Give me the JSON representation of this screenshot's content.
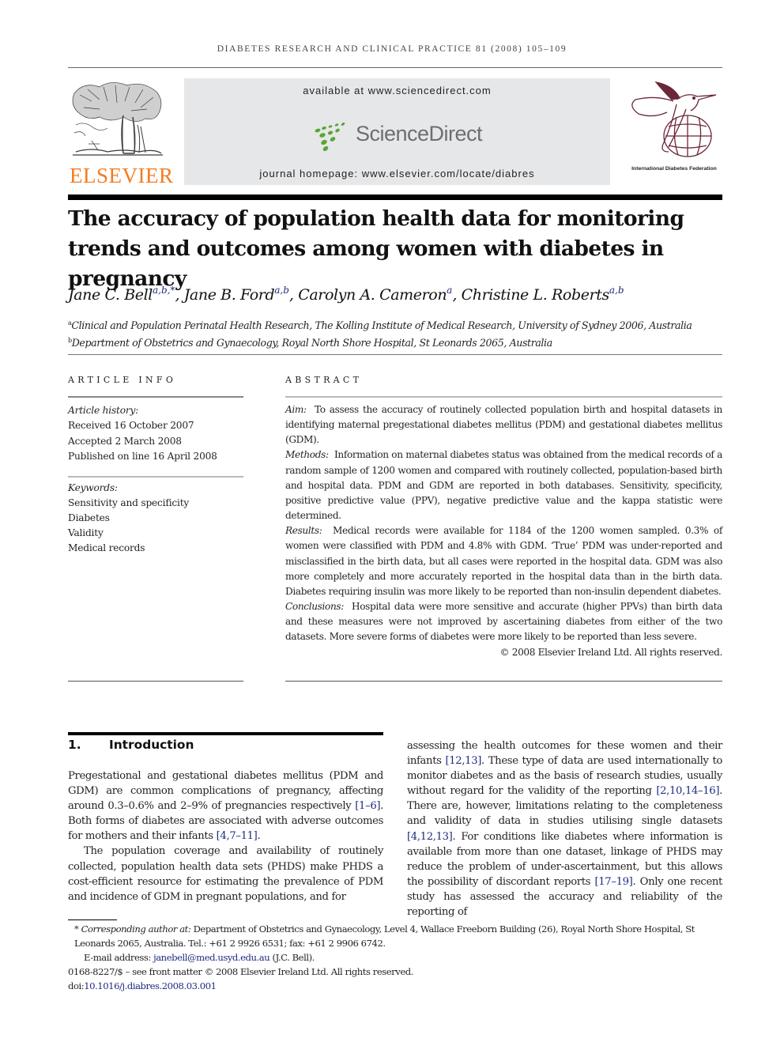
{
  "running_head": "Diabetes Research and Clinical Practice 81 (2008) 105–109",
  "banner": {
    "publisher_logo_text": "ELSEVIER",
    "available_at": "available at www.sciencedirect.com",
    "platform_name": "ScienceDirect",
    "journal_homepage": "journal homepage: www.elsevier.com/locate/diabres",
    "society_name": "International Diabetes Federation",
    "colors": {
      "elsevier_orange": "#f47c20",
      "sciencedirect_green": "#5aa532",
      "idf_maroon": "#6b2737",
      "banner_grey": "#e6e7e8",
      "link_blue": "#1f2a80"
    }
  },
  "article": {
    "title": "The accuracy of population health data for monitoring trends and outcomes among women with diabetes in pregnancy",
    "authors": [
      {
        "name": "Jane C. Bell",
        "affil": "a,b,*"
      },
      {
        "name": "Jane B. Ford",
        "affil": "a,b"
      },
      {
        "name": "Carolyn A. Cameron",
        "affil": "a"
      },
      {
        "name": "Christine L. Roberts",
        "affil": "a,b"
      }
    ],
    "affiliations": [
      {
        "mark": "a",
        "text": "Clinical and Population Perinatal Health Research, The Kolling Institute of Medical Research, University of Sydney 2006, Australia"
      },
      {
        "mark": "b",
        "text": "Department of Obstetrics and Gynaecology, Royal North Shore Hospital, St Leonards 2065, Australia"
      }
    ]
  },
  "article_info": {
    "label": "Article Info",
    "history_label": "Article history:",
    "history": [
      "Received 16 October 2007",
      "Accepted 2 March 2008",
      "Published on line 16 April 2008"
    ],
    "keywords_label": "Keywords:",
    "keywords": [
      "Sensitivity and specificity",
      "Diabetes",
      "Validity",
      "Medical records"
    ]
  },
  "abstract": {
    "label": "Abstract",
    "sections": [
      {
        "label": "Aim:",
        "text": "To assess the accuracy of routinely collected population birth and hospital datasets in identifying maternal pregestational diabetes mellitus (PDM) and gestational diabetes mellitus (GDM)."
      },
      {
        "label": "Methods:",
        "text": "Information on maternal diabetes status was obtained from the medical records of a random sample of 1200 women and compared with routinely collected, population-based birth and hospital data. PDM and GDM are reported in both databases. Sensitivity, specificity, positive predictive value (PPV), negative predictive value and the kappa statistic were determined."
      },
      {
        "label": "Results:",
        "text": "Medical records were available for 1184 of the 1200 women sampled. 0.3% of women were classified with PDM and 4.8% with GDM. ‘True’ PDM was under-reported and misclassified in the birth data, but all cases were reported in the hospital data. GDM was also more completely and more accurately reported in the hospital data than in the birth data. Diabetes requiring insulin was more likely to be reported than non-insulin dependent diabetes."
      },
      {
        "label": "Conclusions:",
        "text": "Hospital data were more sensitive and accurate (higher PPVs) than birth data and these measures were not improved by ascertaining diabetes from either of the two datasets. More severe forms of diabetes were more likely to be reported than less severe."
      }
    ],
    "copyright": "© 2008 Elsevier Ireland Ltd. All rights reserved."
  },
  "introduction": {
    "number": "1.",
    "heading": "Introduction",
    "left_column": [
      {
        "indent": false,
        "parts": [
          {
            "t": "Pregestational and gestational diabetes mellitus (PDM and GDM) are common complications of pregnancy, affecting around 0.3–0.6% and 2–9% of pregnancies respectively "
          },
          {
            "ref": "[1–6]"
          },
          {
            "t": ". Both forms of diabetes are associated with adverse outcomes for mothers and their infants "
          },
          {
            "ref": "[4,7–11]"
          },
          {
            "t": "."
          }
        ]
      },
      {
        "indent": true,
        "parts": [
          {
            "t": "The population coverage and availability of routinely collected, population health data sets (PHDS) make PHDS a cost-efficient resource for estimating the prevalence of PDM and incidence of GDM in pregnant populations, and for"
          }
        ]
      }
    ],
    "right_column": [
      {
        "indent": false,
        "parts": [
          {
            "t": "assessing the health outcomes for these women and their infants "
          },
          {
            "ref": "[12,13]"
          },
          {
            "t": ". These type of data are used internationally to monitor diabetes and as the basis of research studies, usually without regard for the validity of the reporting "
          },
          {
            "ref": "[2,10,14–16]"
          },
          {
            "t": ". There are, however, limitations relating to the completeness and validity of data in studies utilising single datasets "
          },
          {
            "ref": "[4,12,13]"
          },
          {
            "t": ". For conditions like diabetes where information is available from more than one dataset, linkage of PHDS may reduce the problem of under-ascertainment, but this allows the possibility of discordant reports "
          },
          {
            "ref": "[17–19]"
          },
          {
            "t": ". Only one recent study has assessed the accuracy and reliability of the reporting of"
          }
        ]
      }
    ]
  },
  "footnotes": {
    "corresponding_mark": "*",
    "corresponding_label": "Corresponding author at:",
    "corresponding_text": "Department of Obstetrics and Gynaecology, Level 4, Wallace Freeborn Building (26), Royal North Shore Hospital, St Leonards 2065, Australia. Tel.: +61 2 9926 6531; fax: +61 2 9906 6742.",
    "email_label": "E-mail address:",
    "email": "janebell@med.usyd.edu.au",
    "email_suffix": "(J.C. Bell).",
    "front_matter": "0168-8227/$ – see front matter © 2008 Elsevier Ireland Ltd. All rights reserved.",
    "doi_label": "doi:",
    "doi": "10.1016/j.diabres.2008.03.001"
  }
}
